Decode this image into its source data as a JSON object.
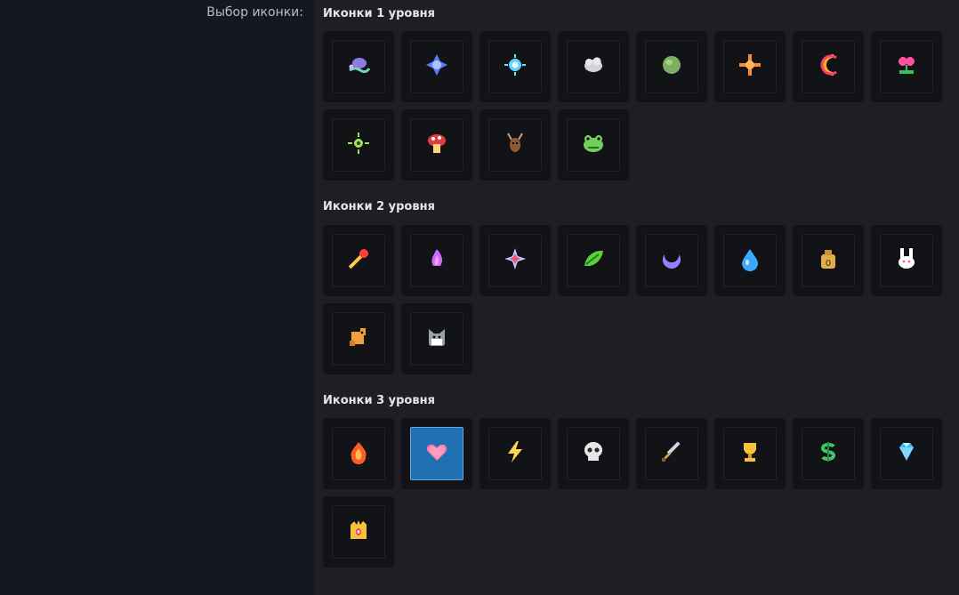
{
  "field": {
    "label": "Выбор иконки:"
  },
  "sections": [
    {
      "title": "Иконки 1 уровня",
      "icons": [
        "snail-icon",
        "sparkle-crystal-icon",
        "sun-gem-icon",
        "stone-cloud-icon",
        "green-egg-icon",
        "orange-star-cross-icon",
        "rainbow-crescent-icon",
        "pink-flower-icon",
        "green-burst-icon",
        "red-mushroom-icon",
        "deer-head-icon",
        "frog-icon"
      ]
    },
    {
      "title": "Иконки 2 уровня",
      "icons": [
        "flaming-arrow-icon",
        "pink-flame-icon",
        "four-point-star-icon",
        "green-leaf-icon",
        "purple-moon-icon",
        "water-drop-icon",
        "money-bag-icon",
        "bunny-icon",
        "orange-dog-icon",
        "gray-cat-icon"
      ]
    },
    {
      "title": "Иконки 3 уровня",
      "icons": [
        "fire-icon",
        "heart-icon",
        "lightning-icon",
        "skull-icon",
        "sword-icon",
        "trophy-icon",
        "dollar-icon",
        "diamond-icon",
        "crown-icon"
      ],
      "selected_index": 1
    }
  ],
  "colors": {
    "selected_bg": "#1f6fb2",
    "tile_bg": "#121316",
    "page_bg": "#1e1f24",
    "left_bg": "#161820"
  }
}
